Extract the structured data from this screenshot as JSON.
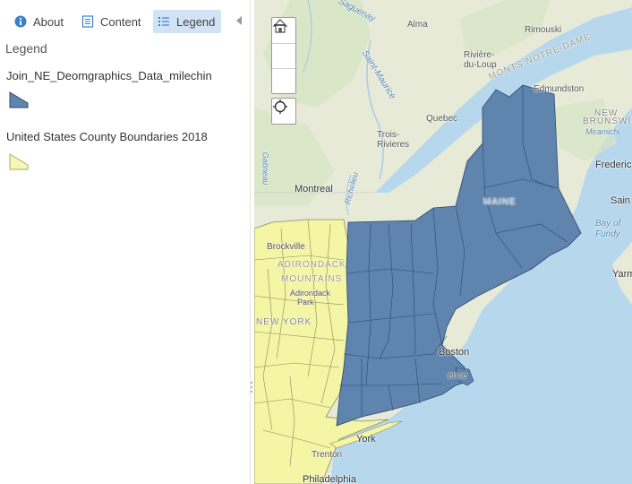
{
  "tabs": {
    "about": "About",
    "content": "Content",
    "legend": "Legend"
  },
  "legend": {
    "heading": "Legend",
    "layers": [
      {
        "title": "Join_NE_Deomgraphics_Data_milechin",
        "fill": "#5f84ad",
        "stroke": "#2c4a6e"
      },
      {
        "title": "United States County Boundaries 2018",
        "fill": "#f8f6b6",
        "stroke": "#a9a870"
      }
    ]
  },
  "map": {
    "colors": {
      "water": "#b7d8ec",
      "land": "#e8ead8",
      "ne_fill": "#5f84ad",
      "us_fill": "#f4f5a5"
    },
    "labels": {
      "alma": "Alma",
      "rimouski": "Rimouski",
      "riviere": "Rivière-",
      "du_loup": "du-Loup",
      "monts": "MONTS NOTRE-DAME",
      "edmundston": "Edmundston",
      "quebec": "Quebec",
      "new": "NEW",
      "brunswick": "BRUNSWIC",
      "miramichi": "Miramichi",
      "trois": "Trois-",
      "rivieres": "Rivieres",
      "fredericton": "Frederic",
      "saint_john": "Sain",
      "montreal": "Montreal",
      "bay": "Bay of",
      "fundy": "Fundy",
      "brockville": "Brockville",
      "adirondack": "ADIRONDACK",
      "mountains": "MOUNTAINS",
      "adirondack_park": "Adirondack",
      "park": "Park",
      "new_york": "NEW YORK",
      "yarmouth": "Yarm",
      "boston": "Boston",
      "providence": "ence",
      "york": "York",
      "trenton": "Trenton",
      "philadelphia": "Philadelphia",
      "saguenay": "Saguenay",
      "saint_maurice": "Saint-Maurice",
      "richelieu": "Richelieu",
      "gatineau": "Gatineau",
      "maine": "MAINE"
    }
  }
}
